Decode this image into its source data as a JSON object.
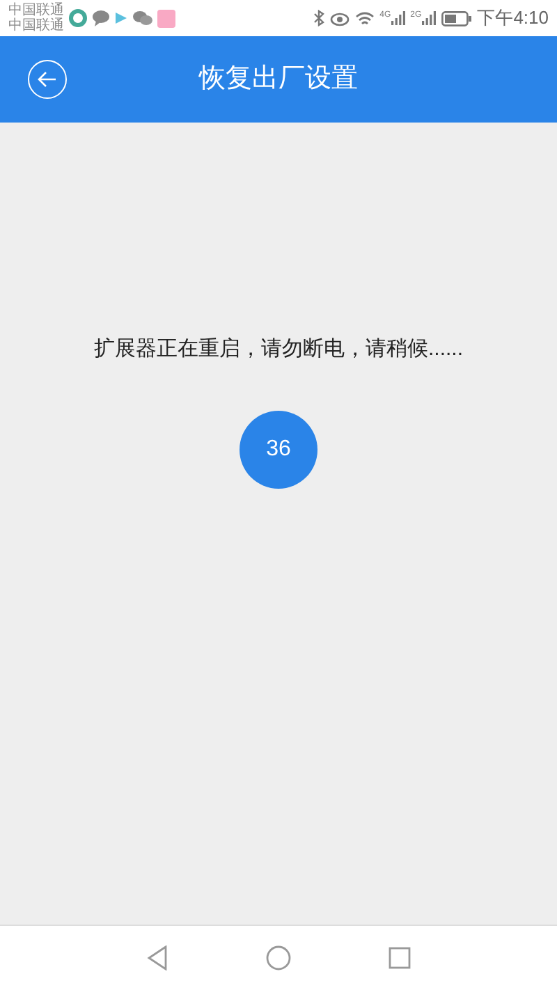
{
  "status_bar": {
    "carriers": [
      "中国联通",
      "中国联通"
    ],
    "network_labels": [
      "4G",
      "2G"
    ],
    "time": "下午4:10"
  },
  "header": {
    "title": "恢复出厂设置"
  },
  "message": "扩展器正在重启，请勿断电，请稍候......",
  "countdown": "36"
}
